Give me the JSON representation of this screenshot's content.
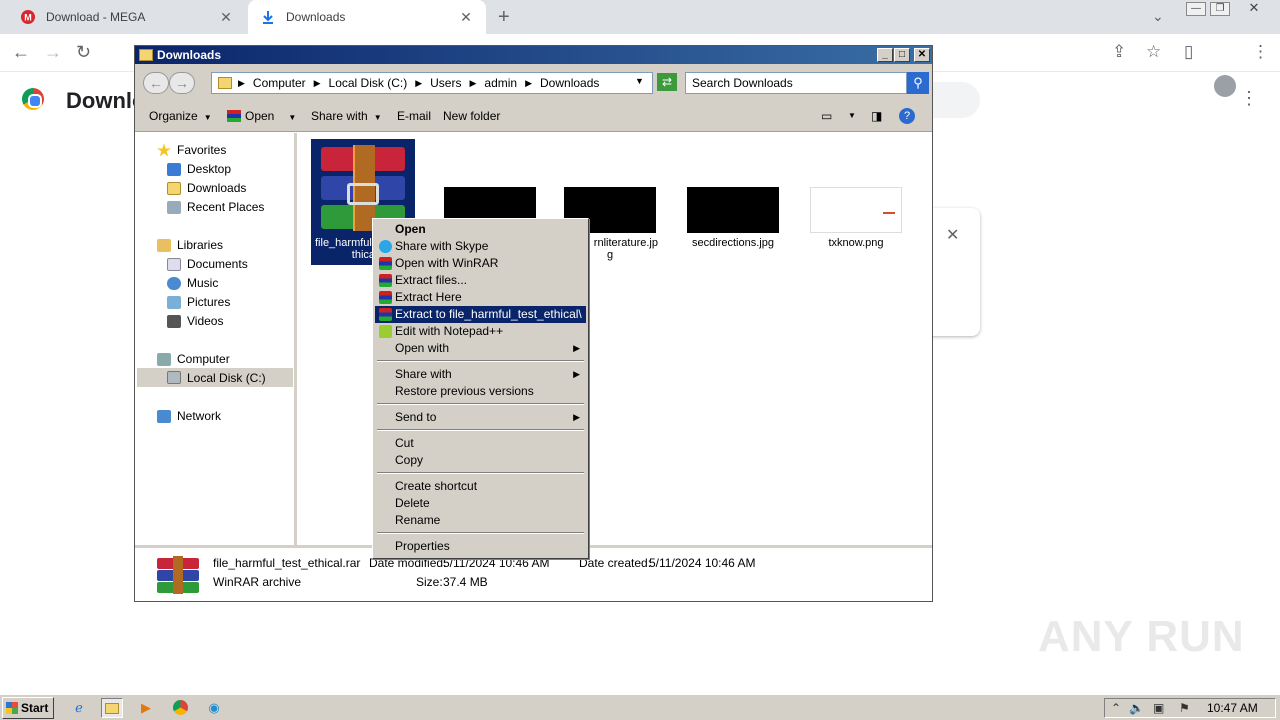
{
  "chrome": {
    "tabs": [
      {
        "title": "Download - MEGA",
        "icon": "mega-icon"
      },
      {
        "title": "Downloads",
        "icon": "download-icon"
      }
    ],
    "page_title": "Downlo"
  },
  "explorer": {
    "title": "Downloads",
    "breadcrumb": [
      "Computer",
      "Local Disk (C:)",
      "Users",
      "admin",
      "Downloads"
    ],
    "search_placeholder": "Search Downloads",
    "commands": {
      "organize": "Organize",
      "open": "Open",
      "share_with": "Share with",
      "email": "E-mail",
      "new_folder": "New folder"
    },
    "nav": {
      "favorites": "Favorites",
      "desktop": "Desktop",
      "downloads": "Downloads",
      "recent_places": "Recent Places",
      "libraries": "Libraries",
      "documents": "Documents",
      "music": "Music",
      "pictures": "Pictures",
      "videos": "Videos",
      "computer": "Computer",
      "local_disk": "Local Disk (C:)",
      "network": "Network"
    },
    "files": {
      "rar_line1": "file_harmful",
      "rar_line2": "thical.r",
      "jpg2_line1": "rnliterature.jp",
      "jpg2_line2": "g",
      "jpg3": "secdirections.jpg",
      "png": "txknow.png"
    },
    "status": {
      "filename": "file_harmful_test_ethical.rar",
      "type": "WinRAR archive",
      "date_modified_label": "Date modified:",
      "date_modified": "5/11/2024 10:46 AM",
      "date_created_label": "Date created:",
      "date_created": "5/11/2024 10:46 AM",
      "size_label": "Size:",
      "size": "37.4 MB"
    }
  },
  "context_menu": {
    "open": "Open",
    "share_skype": "Share with Skype",
    "open_winrar": "Open with WinRAR",
    "extract_files": "Extract files...",
    "extract_here": "Extract Here",
    "extract_to": "Extract to file_harmful_test_ethical\\",
    "edit_notepad": "Edit with Notepad++",
    "open_with": "Open with",
    "share_with": "Share with",
    "restore": "Restore previous versions",
    "send_to": "Send to",
    "cut": "Cut",
    "copy": "Copy",
    "create_shortcut": "Create shortcut",
    "delete": "Delete",
    "rename": "Rename",
    "properties": "Properties"
  },
  "taskbar": {
    "start": "Start",
    "clock": "10:47 AM"
  },
  "watermark": "ANY RUN",
  "colors": {
    "selection": "#0a246a",
    "titlebar": "#0a246a",
    "win_face": "#d4d0c8"
  }
}
